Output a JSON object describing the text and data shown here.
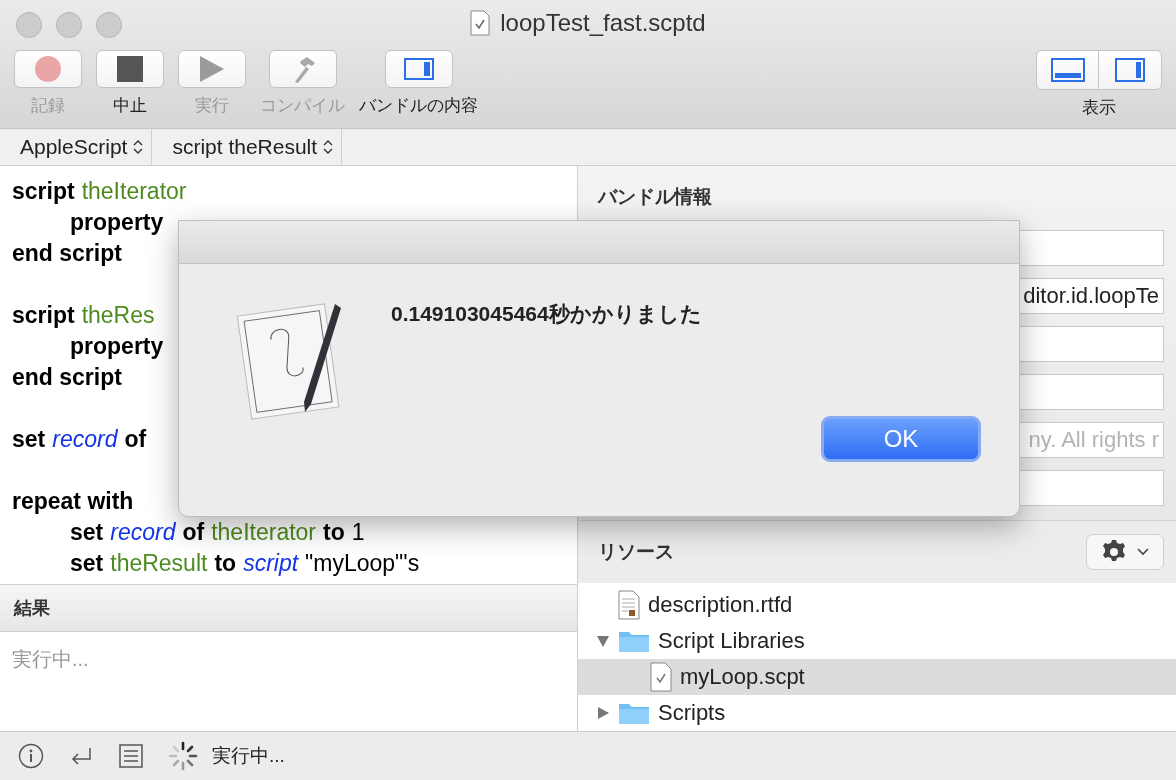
{
  "window": {
    "title": "loopTest_fast.scptd"
  },
  "toolbar": {
    "buttons": [
      {
        "kind": "record",
        "label": "記録",
        "disabled": true
      },
      {
        "kind": "stop",
        "label": "中止",
        "disabled": false
      },
      {
        "kind": "run",
        "label": "実行",
        "disabled": true
      },
      {
        "kind": "compile",
        "label": "コンパイル",
        "disabled": true
      },
      {
        "kind": "bundle",
        "label": "バンドルの内容",
        "disabled": false
      }
    ],
    "view": {
      "label": "表示",
      "segments": [
        {
          "kind": "bottom",
          "selected": false
        },
        {
          "kind": "side",
          "selected": false
        }
      ]
    }
  },
  "navigator": [
    "AppleScript",
    "script theResult"
  ],
  "editor": {
    "lines": [
      {
        "tokens": [
          {
            "kind": "keyword",
            "text": "script"
          },
          {
            "kind": "var",
            "text": "theIterator"
          }
        ]
      },
      {
        "indent": true,
        "tokens": [
          {
            "kind": "keyword",
            "text": "property"
          }
        ]
      },
      {
        "tokens": [
          {
            "kind": "keyword",
            "text": "end script"
          }
        ]
      },
      {
        "blank_before": true,
        "tokens": [
          {
            "kind": "keyword",
            "text": "script"
          },
          {
            "kind": "var",
            "text": "theRes"
          }
        ]
      },
      {
        "indent": true,
        "tokens": [
          {
            "kind": "keyword",
            "text": "property"
          }
        ]
      },
      {
        "tokens": [
          {
            "kind": "keyword",
            "text": "end script"
          }
        ]
      },
      {
        "blank_before": true,
        "tokens": [
          {
            "kind": "keyword",
            "text": "set"
          },
          {
            "kind": "prop",
            "text": "record"
          },
          {
            "kind": "keyword",
            "text": "of"
          }
        ]
      },
      {
        "blank_before": true,
        "tokens": [
          {
            "kind": "keyword",
            "text": "repeat with"
          }
        ]
      },
      {
        "indent": true,
        "tokens": [
          {
            "kind": "keyword",
            "text": "set"
          },
          {
            "kind": "prop",
            "text": "record"
          },
          {
            "kind": "keyword",
            "text": "of"
          },
          {
            "kind": "var",
            "text": "theIterator"
          },
          {
            "kind": "keyword",
            "text": "to"
          },
          {
            "kind": "plain",
            "text": "1"
          }
        ]
      },
      {
        "indent": true,
        "tokens": [
          {
            "kind": "keyword",
            "text": "set"
          },
          {
            "kind": "var",
            "text": "theResult"
          },
          {
            "kind": "keyword",
            "text": "to"
          },
          {
            "kind": "prop",
            "text": "script"
          },
          {
            "kind": "plain",
            "text": "\"myLoop\"'s"
          }
        ]
      }
    ]
  },
  "result": {
    "title": "結果",
    "text": "実行中..."
  },
  "bundle_info": {
    "title": "バンドル情報",
    "fields": [
      {
        "kind": "empty"
      },
      {
        "kind": "text",
        "value": "ditor.id.loopTe"
      },
      {
        "kind": "empty"
      },
      {
        "kind": "empty"
      },
      {
        "kind": "hint",
        "placeholder": "ny. All rights r"
      },
      {
        "kind": "empty"
      }
    ]
  },
  "resources": {
    "title": "リソース",
    "items": [
      {
        "kind": "file",
        "name": "description.rtfd",
        "selected": false
      },
      {
        "kind": "folder",
        "name": "Script Libraries",
        "expanded": true,
        "selected": false,
        "children": [
          {
            "kind": "script",
            "name": "myLoop.scpt",
            "selected": true
          }
        ]
      },
      {
        "kind": "folder",
        "name": "Scripts",
        "expanded": false,
        "selected": false
      }
    ]
  },
  "status_bar": {
    "text": "実行中..."
  },
  "dialog": {
    "message": "0.149103045464秒かかりました",
    "button": "OK"
  }
}
